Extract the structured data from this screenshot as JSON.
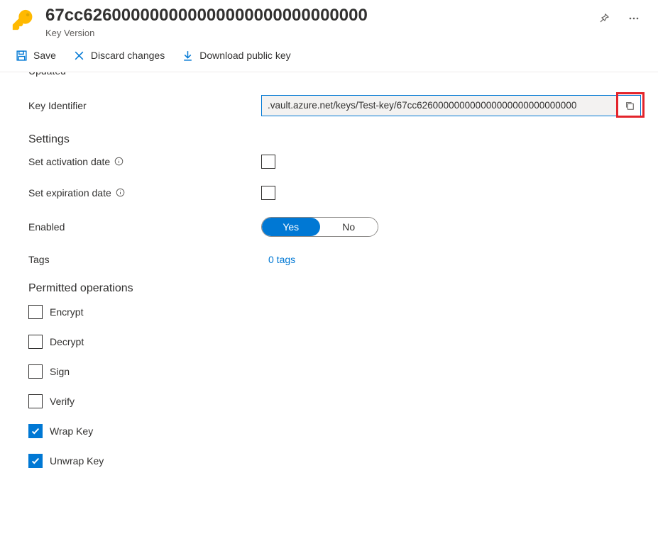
{
  "header": {
    "title": "67cc626000000000000000000000000000",
    "subtitle": "Key Version"
  },
  "toolbar": {
    "save": "Save",
    "discard": "Discard changes",
    "download": "Download public key"
  },
  "updated_label": "Updated",
  "key_identifier": {
    "label": "Key Identifier",
    "value": ".vault.azure.net/keys/Test-key/67cc626000000000000000000000000000"
  },
  "settings": {
    "heading": "Settings",
    "activation_label": "Set activation date",
    "expiration_label": "Set expiration date",
    "enabled_label": "Enabled",
    "enabled_yes": "Yes",
    "enabled_no": "No"
  },
  "tags": {
    "label": "Tags",
    "value": "0 tags"
  },
  "permitted": {
    "heading": "Permitted operations",
    "ops": [
      {
        "label": "Encrypt",
        "checked": false
      },
      {
        "label": "Decrypt",
        "checked": false
      },
      {
        "label": "Sign",
        "checked": false
      },
      {
        "label": "Verify",
        "checked": false
      },
      {
        "label": "Wrap Key",
        "checked": true
      },
      {
        "label": "Unwrap Key",
        "checked": true
      }
    ]
  }
}
